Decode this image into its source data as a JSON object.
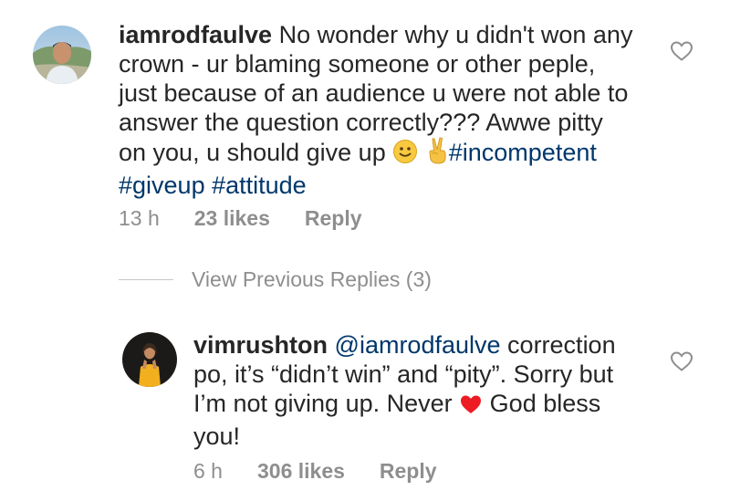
{
  "comment": {
    "username": "iamrodfaulve",
    "text_line1": "No wonder why u didn't won any",
    "text_line2": "crown - ur blaming someone or other peple,",
    "text_line3": "just because of an audience u were not able to",
    "text_line4": "answer the question correctly??? Awwe pitty",
    "text_line5_start": "on you, u should give up",
    "hashtag1": "#incompetent",
    "hashtag2": "#giveup",
    "hashtag3": "#attitude",
    "time": "13 h",
    "likes": "23 likes",
    "reply_label": "Reply",
    "emojis": [
      "slightly-smiling-face-emoji",
      "victory-hand-emoji"
    ]
  },
  "thread": {
    "view_previous_label": "View Previous Replies (3)"
  },
  "reply": {
    "username": "vimrushton",
    "mention": "@iamrodfaulve",
    "text_line1_rest": "correction",
    "text_line2": "po, it’s “didn’t win” and “pity”. Sorry but",
    "text_line3_start": "I’m not giving up. Never",
    "text_line3_end": "God bless",
    "text_line4": "you!",
    "time": "6 h",
    "likes": "306 likes",
    "reply_label": "Reply",
    "emojis": [
      "red-heart-emoji"
    ]
  },
  "colors": {
    "text": "#262626",
    "secondary": "#8e8e8e",
    "link": "#00376b",
    "heart_red": "#ed1c24"
  }
}
